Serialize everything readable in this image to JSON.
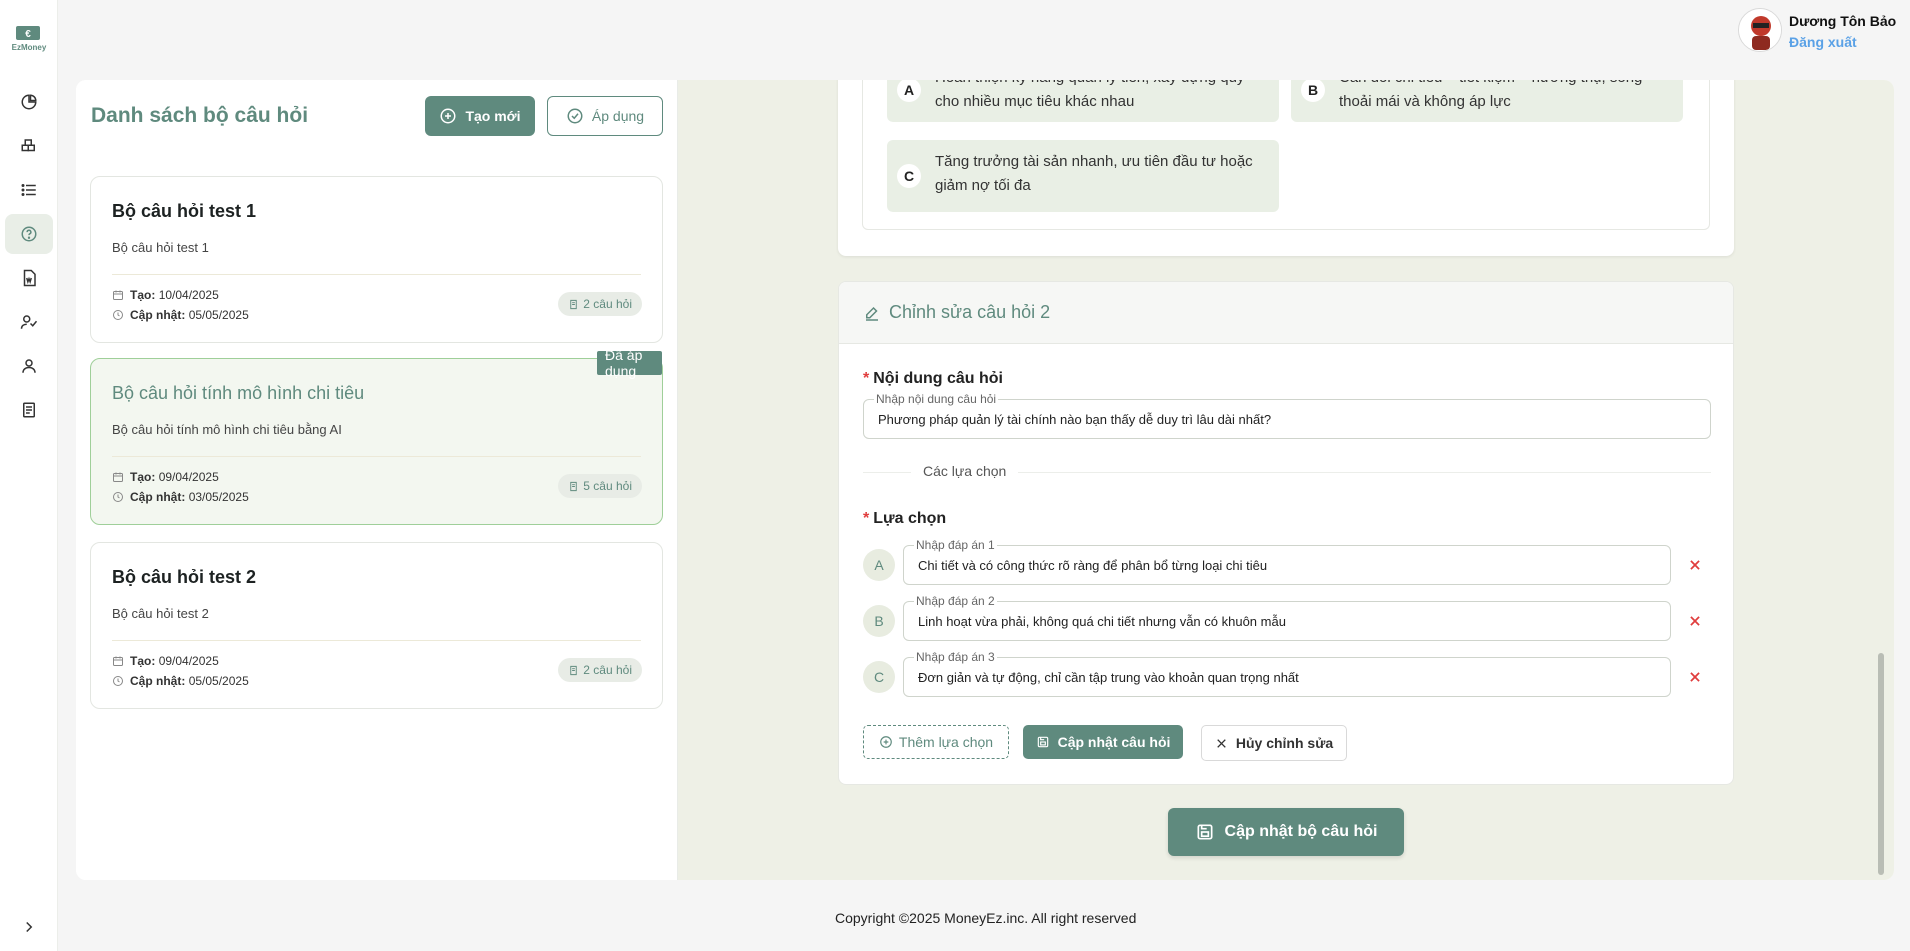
{
  "brand": {
    "logo_text": "EzMoney",
    "accent": "#5f8a7e"
  },
  "header": {
    "user_name": "Dương Tôn Bảo",
    "logout_label": "Đăng xuất"
  },
  "sidebar": {
    "items": [
      {
        "icon": "pie-chart-icon"
      },
      {
        "icon": "blocks-icon"
      },
      {
        "icon": "list-icon"
      },
      {
        "icon": "question-icon",
        "active": true
      },
      {
        "icon": "document-icon"
      },
      {
        "icon": "users-icon"
      },
      {
        "icon": "user-icon"
      },
      {
        "icon": "book-icon"
      }
    ]
  },
  "left": {
    "title": "Danh sách bộ câu hỏi",
    "new_label": "Tạo mới",
    "apply_label": "Áp dụng",
    "cards": [
      {
        "title": "Bộ câu hỏi test 1",
        "desc": "Bộ câu hỏi test 1",
        "created_label": "Tạo:",
        "created": "10/04/2025",
        "updated_label": "Cập nhật:",
        "updated": "05/05/2025",
        "count": "2 câu hỏi"
      },
      {
        "title": "Bộ câu hỏi tính mô hình chi tiêu",
        "desc": "Bộ câu hỏi tính mô hình chi tiêu bằng AI",
        "created_label": "Tạo:",
        "created": "09/04/2025",
        "updated_label": "Cập nhật:",
        "updated": "03/05/2025",
        "count": "5 câu hỏi",
        "badge": "Đã áp dụng"
      },
      {
        "title": "Bộ câu hỏi test 2",
        "desc": "Bộ câu hỏi test 2",
        "created_label": "Tạo:",
        "created": "09/04/2025",
        "updated_label": "Cập nhật:",
        "updated": "05/05/2025",
        "count": "2 câu hỏi"
      }
    ]
  },
  "right": {
    "prev_options": [
      {
        "letter": "A",
        "text": "Hoàn thiện kỹ năng quản lý tiền, xây dựng quỹ cho nhiều mục tiêu khác nhau"
      },
      {
        "letter": "B",
        "text": "Cân đối chi tiêu – tiết kiệm – hưởng thụ, sống thoải mái và không áp lực"
      },
      {
        "letter": "C",
        "text": "Tăng trưởng tài sản nhanh, ưu tiên đầu tư hoặc giảm nợ tối đa"
      }
    ],
    "edit": {
      "title": "Chỉnh sửa câu hỏi 2",
      "content_label": "Nội dung câu hỏi",
      "content_float": "Nhập nội dung câu hỏi",
      "content_value": "Phương pháp quản lý tài chính nào bạn thấy dễ duy trì lâu dài nhất?",
      "divider_text": "Các lựa chọn",
      "choices_label": "Lựa chọn",
      "choices": [
        {
          "letter": "A",
          "float": "Nhập đáp án 1",
          "value": "Chi tiết và có công thức rõ ràng để phân bổ từng loại chi tiêu"
        },
        {
          "letter": "B",
          "float": "Nhập đáp án 2",
          "value": "Linh hoạt vừa phải, không quá chi tiết nhưng vẫn có khuôn mẫu"
        },
        {
          "letter": "C",
          "float": "Nhập đáp án 3",
          "value": "Đơn giản và tự động, chỉ cần tập trung vào khoản quan trọng nhất"
        }
      ],
      "add_choice_label": "Thêm lựa chọn",
      "update_question_label": "Cập nhật câu hỏi",
      "cancel_label": "Hủy chỉnh sửa"
    },
    "update_set_label": "Cập nhật bộ câu hỏi"
  },
  "footer": {
    "copyright": "Copyright ©2025 MoneyEz.inc. All right reserved"
  }
}
